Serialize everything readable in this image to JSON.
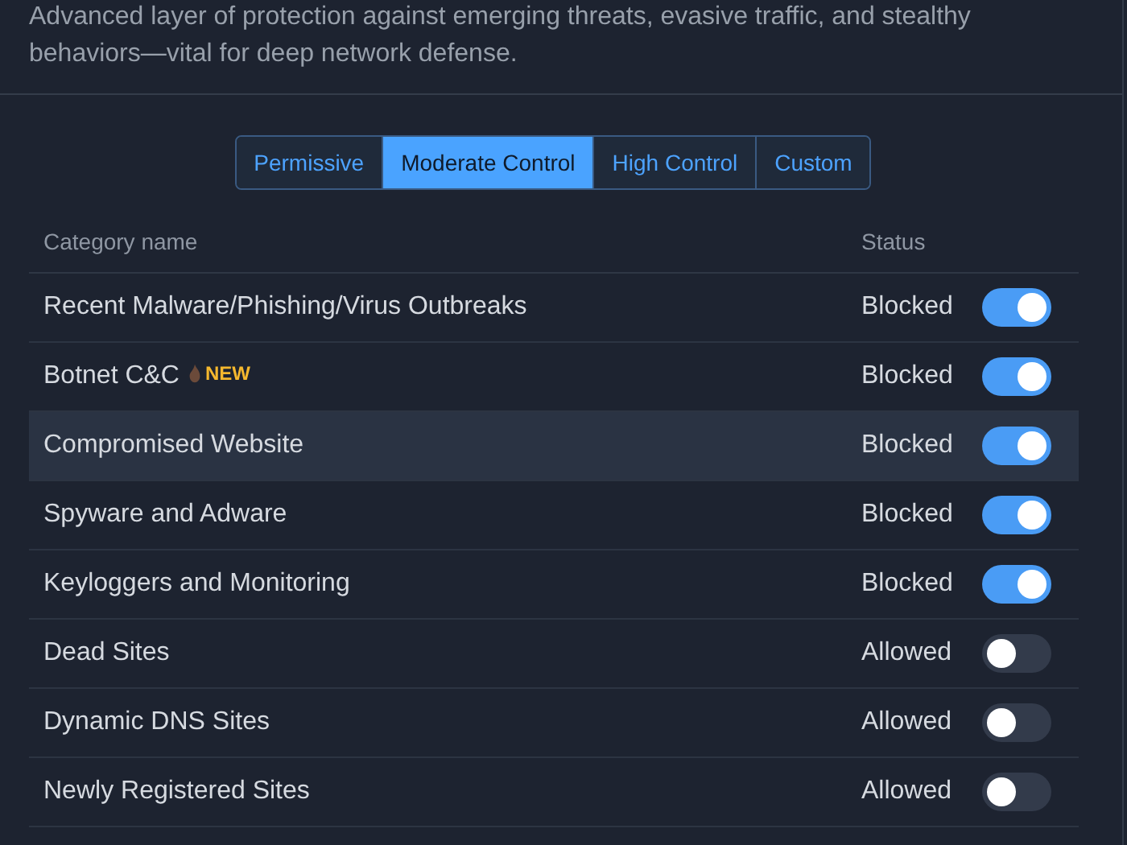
{
  "description": "Advanced layer of protection against emerging threats, evasive traffic, and stealthy behaviors—vital for deep network defense.",
  "modes": [
    {
      "label": "Permissive",
      "selected": false
    },
    {
      "label": "Moderate Control",
      "selected": true
    },
    {
      "label": "High Control",
      "selected": false
    },
    {
      "label": "Custom",
      "selected": false
    }
  ],
  "table": {
    "columns": [
      "Category name",
      "Status"
    ],
    "rows": [
      {
        "name": "Recent Malware/Phishing/Virus Outbreaks",
        "status": "Blocked",
        "on": true,
        "highlighted": false
      },
      {
        "name": "Botnet C&C",
        "badge": "NEW",
        "status": "Blocked",
        "on": true,
        "highlighted": false
      },
      {
        "name": "Compromised Website",
        "status": "Blocked",
        "on": true,
        "highlighted": true
      },
      {
        "name": "Spyware and Adware",
        "status": "Blocked",
        "on": true,
        "highlighted": false
      },
      {
        "name": "Keyloggers and Monitoring",
        "status": "Blocked",
        "on": true,
        "highlighted": false
      },
      {
        "name": "Dead Sites",
        "status": "Allowed",
        "on": false,
        "highlighted": false
      },
      {
        "name": "Dynamic DNS Sites",
        "status": "Allowed",
        "on": false,
        "highlighted": false
      },
      {
        "name": "Newly Registered Sites",
        "status": "Allowed",
        "on": false,
        "highlighted": false
      }
    ]
  }
}
